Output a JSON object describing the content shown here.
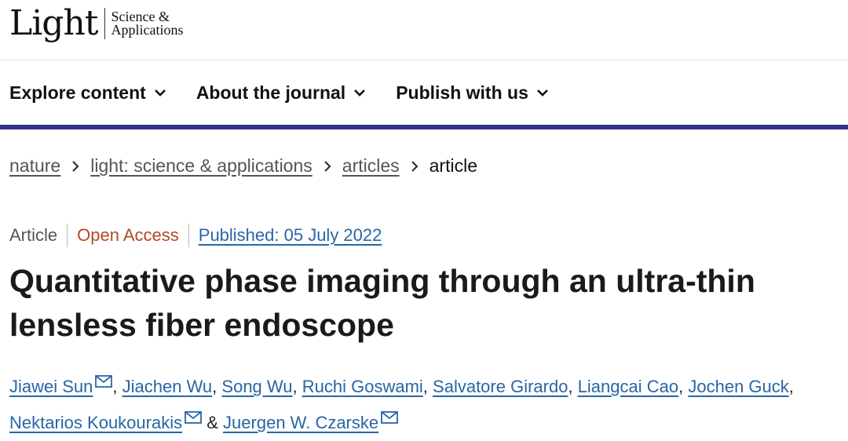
{
  "logo": {
    "wordmark": "Light",
    "subtitle_line1": "Science &",
    "subtitle_line2": "Applications"
  },
  "nav": {
    "items": [
      {
        "label": "Explore content"
      },
      {
        "label": "About the journal"
      },
      {
        "label": "Publish with us"
      }
    ]
  },
  "breadcrumb": {
    "items": [
      "nature",
      "light: science & applications",
      "articles"
    ],
    "current": "article"
  },
  "article": {
    "type": "Article",
    "access": "Open Access",
    "published": "Published: 05 July 2022",
    "title": "Quantitative phase imaging through an ultra-thin lensless fiber endoscope"
  },
  "authors": {
    "list": [
      "Jiawei Sun",
      "Jiachen Wu",
      "Song Wu",
      "Ruchi Goswami",
      "Salvatore Girardo",
      "Liangcai Cao",
      "Jochen Guck",
      "Nektarios Koukourakis",
      "Juergen W. Czarske"
    ],
    "amp": "&"
  },
  "colors": {
    "nav_border": "#33338a",
    "link": "#2866a5",
    "open_access": "#b24a26"
  },
  "icons": {
    "nav_chevron": "chevron-down-icon",
    "breadcrumb_sep": "chevron-right-icon",
    "author_email": "mail-icon"
  }
}
